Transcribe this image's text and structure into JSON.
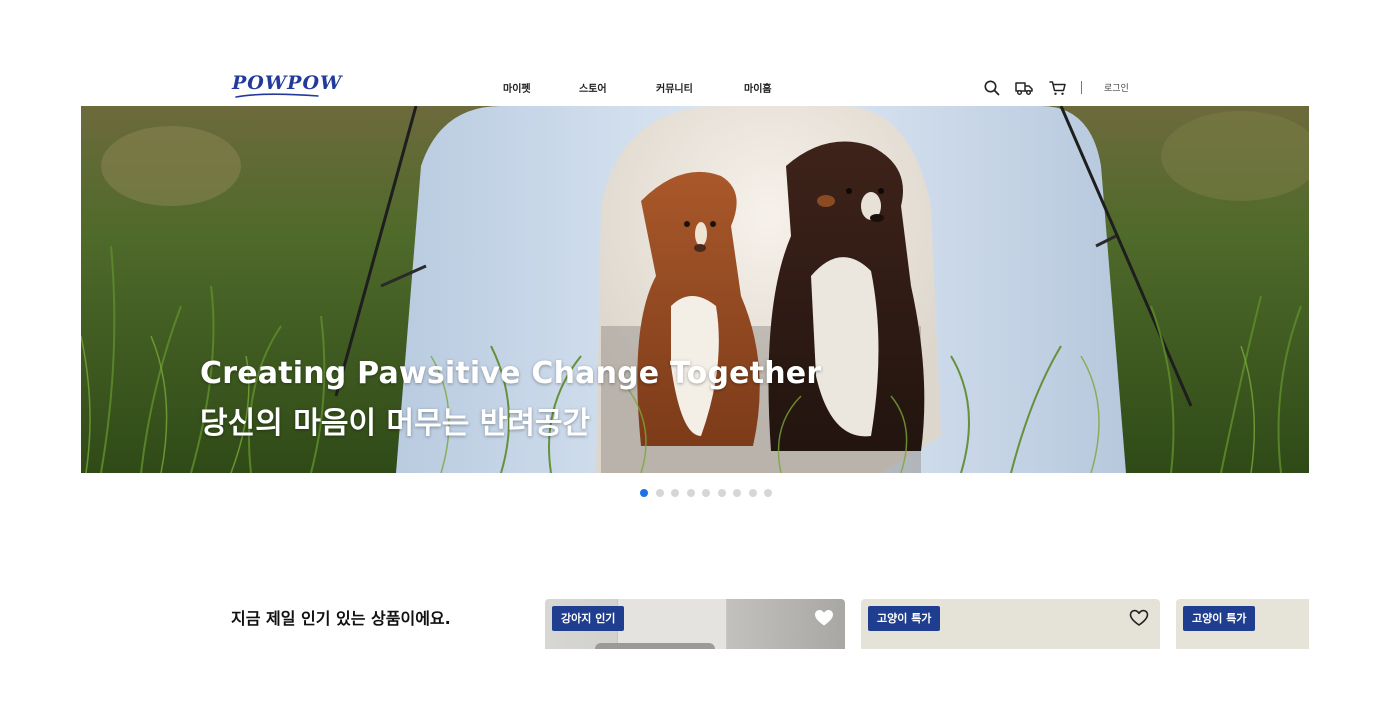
{
  "header": {
    "logo_text": "POWPOW",
    "nav": [
      {
        "label": "마이펫"
      },
      {
        "label": "스토어"
      },
      {
        "label": "커뮤니티"
      },
      {
        "label": "마이홈"
      }
    ],
    "icons": [
      "search-icon",
      "delivery-truck-icon",
      "cart-icon"
    ],
    "login_label": "로그인"
  },
  "hero": {
    "title": "Creating Pawsitive Change Together",
    "subtitle": "당신의 마음이 머무는 반려공간",
    "slide_count": 9,
    "active_slide": 1
  },
  "popular": {
    "title": "지금 제일 인기 있는 상품이에요.",
    "cards": [
      {
        "badge": "강아지 인기",
        "favorited": true
      },
      {
        "badge": "고양이 특가",
        "favorited": false
      },
      {
        "badge": "고양이 특가",
        "favorited": false
      }
    ]
  },
  "colors": {
    "brand_blue": "#243a9a",
    "badge_blue": "#1f3e8f",
    "active_dot": "#1a73e8",
    "inactive_dot": "#d6d6d6"
  }
}
